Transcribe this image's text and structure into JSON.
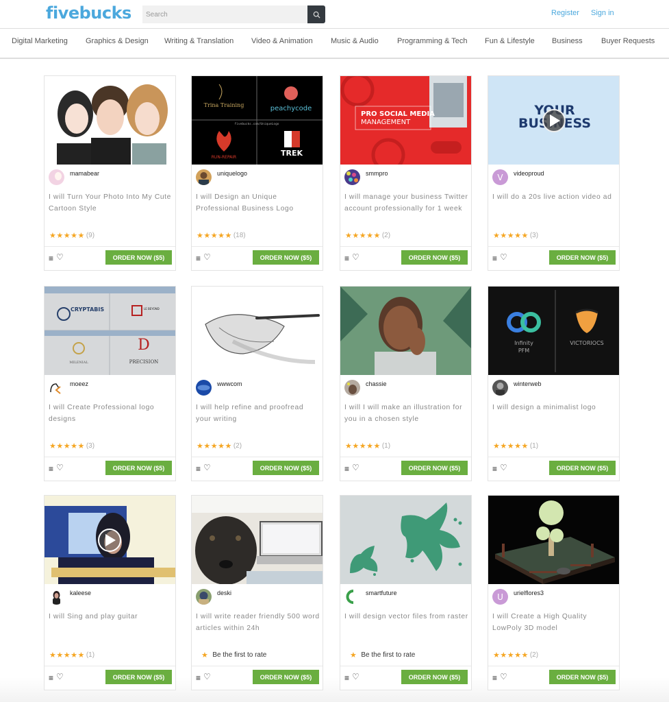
{
  "header": {
    "logo": "fivebucks",
    "search_placeholder": "Search",
    "search_icon": "search-icon",
    "register": "Register",
    "signin": "Sign in"
  },
  "nav": [
    "Digital Marketing",
    "Graphics & Design",
    "Writing & Translation",
    "Video & Animation",
    "Music & Audio",
    "Programming & Tech",
    "Fun & Lifestyle",
    "Business",
    "Buyer Requests"
  ],
  "colors": {
    "brand": "#4ba8dd",
    "order_button": "#6aae40",
    "star": "#f5a623"
  },
  "gigs": [
    {
      "seller": "mamabear",
      "title": "I will Turn Your Photo Into My Cute Cartoon Style",
      "stars": 5,
      "count": "(9)"
    },
    {
      "seller": "uniquelogo",
      "title": "I will Design an Unique Professional Business Logo",
      "stars": 5,
      "count": "(18)",
      "thumb_text": [
        "Trina Training",
        "peachycode",
        "RUN-REPAIR",
        "TREK",
        "fivebucks.com/UniqueLogo"
      ]
    },
    {
      "seller": "smmpro",
      "title": "I will manage your business Twitter account professionally for 1 week",
      "stars": 5,
      "count": "(2)",
      "thumb_text": [
        "PRO SOCIAL MEDIA",
        "MANAGEMENT"
      ]
    },
    {
      "seller": "videoproud",
      "title": "I will do a 20s live action video ad",
      "stars": 5,
      "count": "(3)",
      "avatar_letter": "V",
      "thumb_text": [
        "YOUR",
        "BUSINESS"
      ]
    },
    {
      "seller": "moeez",
      "title": "I will Create Professional logo designs",
      "stars": 5,
      "count": "(3)",
      "thumb_text": [
        "CRYPTABIS",
        "PRECISION",
        "MILENIAL"
      ]
    },
    {
      "seller": "wwwcom",
      "title": "I will help refine and proofread your writing",
      "stars": 5,
      "count": "(2)"
    },
    {
      "seller": "chassie",
      "title": "I will I will make an illustration for you in a chosen style",
      "stars": 5,
      "count": "(1)"
    },
    {
      "seller": "winterweb",
      "title": "I will design a minimalist logo",
      "stars": 5,
      "count": "(1)",
      "thumb_text": [
        "Infinity",
        "PFM",
        "VICTORIOCS"
      ]
    },
    {
      "seller": "kaleese",
      "title": "I will Sing and play guitar",
      "stars": 5,
      "count": "(1)"
    },
    {
      "seller": "deski",
      "title": "I will write reader friendly 500 word articles within 24h",
      "stars": 0,
      "count": "",
      "first_rate": "Be the first to rate"
    },
    {
      "seller": "smartfuture",
      "title": "I will design vector files from raster",
      "stars": 0,
      "count": "",
      "first_rate": "Be the first to rate"
    },
    {
      "seller": "urielflores3",
      "title": "I will Create a High Quality LowPoly 3D model",
      "stars": 5,
      "count": "(2)",
      "avatar_letter": "U"
    }
  ],
  "card_actions": {
    "order_label": "ORDER NOW ($5)",
    "menu_icon": "≡",
    "heart_icon": "♡",
    "star_glyphs": "★★★★★",
    "single_star": "★"
  }
}
